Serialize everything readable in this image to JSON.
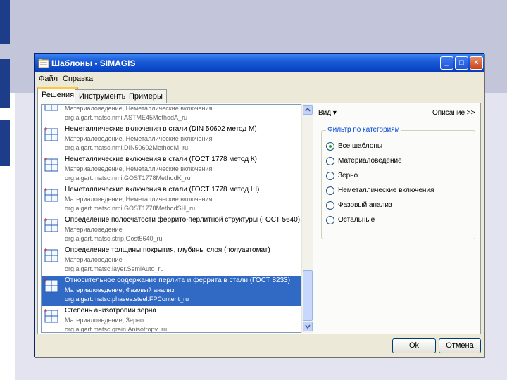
{
  "window": {
    "title": "Шаблоны - SIMAGIS",
    "controls": {
      "minimize": "_",
      "maximize": "□",
      "close": "×"
    }
  },
  "menu": [
    "Файл",
    "Справка"
  ],
  "tabs": [
    {
      "label": "Решения",
      "active": true
    },
    {
      "label": "Инструменты",
      "active": false
    },
    {
      "label": "Примеры",
      "active": false
    }
  ],
  "templates": [
    {
      "title": "",
      "category": "Материаловедение, Неметаллические включения",
      "class": "org.algart.matsc.nmi.ASTME45MethodA_ru",
      "selected": false,
      "starred": false
    },
    {
      "title": "Неметаллические включения в стали (DIN 50602 метод М)",
      "category": "Материаловедение, Неметаллические включения",
      "class": "org.algart.matsc.nmi.DIN50602MethodM_ru",
      "selected": false,
      "starred": true
    },
    {
      "title": "Неметаллические включения в стали (ГОСТ 1778 метод К)",
      "category": "Материаловедение, Неметаллические включения",
      "class": "org.algart.matsc.nmi.GOST1778MethodK_ru",
      "selected": false,
      "starred": true
    },
    {
      "title": "Неметаллические включения в стали (ГОСТ 1778 метод Ш)",
      "category": "Материаловедение, Неметаллические включения",
      "class": "org.algart.matsc.nmi.GOST1778MethodSH_ru",
      "selected": false,
      "starred": true
    },
    {
      "title": "Определение полосчатости феррито-перлитной структуры (ГОСТ 5640)",
      "category": "Материаловедение",
      "class": "org.algart.matsc.strip.Gost5640_ru",
      "selected": false,
      "starred": true
    },
    {
      "title": "Определение толщины покрытия, глубины слоя (полуавтомат)",
      "category": "Материаловедение",
      "class": "org.algart.matsc.layer.SemiAuto_ru",
      "selected": false,
      "starred": true
    },
    {
      "title": "Относительное содержание перлита и феррита в стали (ГОСТ 8233)",
      "category": "Материаловедение, Фазовый анализ",
      "class": "org.algart.matsc.phases.steel.FPContent_ru",
      "selected": true,
      "starred": true
    },
    {
      "title": "Степень анизотропии зерна",
      "category": "Материаловедение, Зерно",
      "class": "org.algart.matsc.grain.Anisotropy_ru",
      "selected": false,
      "starred": true
    }
  ],
  "view": {
    "label": "Вид ▾",
    "description": "Описание >>"
  },
  "filter": {
    "legend": "Фильтр по категориям",
    "options": [
      "Все шаблоны",
      "Материаловедение",
      "Зерно",
      "Неметаллические включения",
      "Фазовый анализ",
      "Остальные"
    ],
    "selected": "Все шаблоны"
  },
  "buttons": {
    "ok": "Ok",
    "cancel": "Отмена"
  },
  "colors": {
    "accent": "#316ac5",
    "titlebar": "#0a48c8",
    "star": "#d42020",
    "slide_bg": "#c3c5da",
    "slide_block": "#1d3d8a"
  },
  "icons": {
    "app": "templates-app-icon",
    "item": "template-grid-icon",
    "star": "new-star-icon"
  }
}
